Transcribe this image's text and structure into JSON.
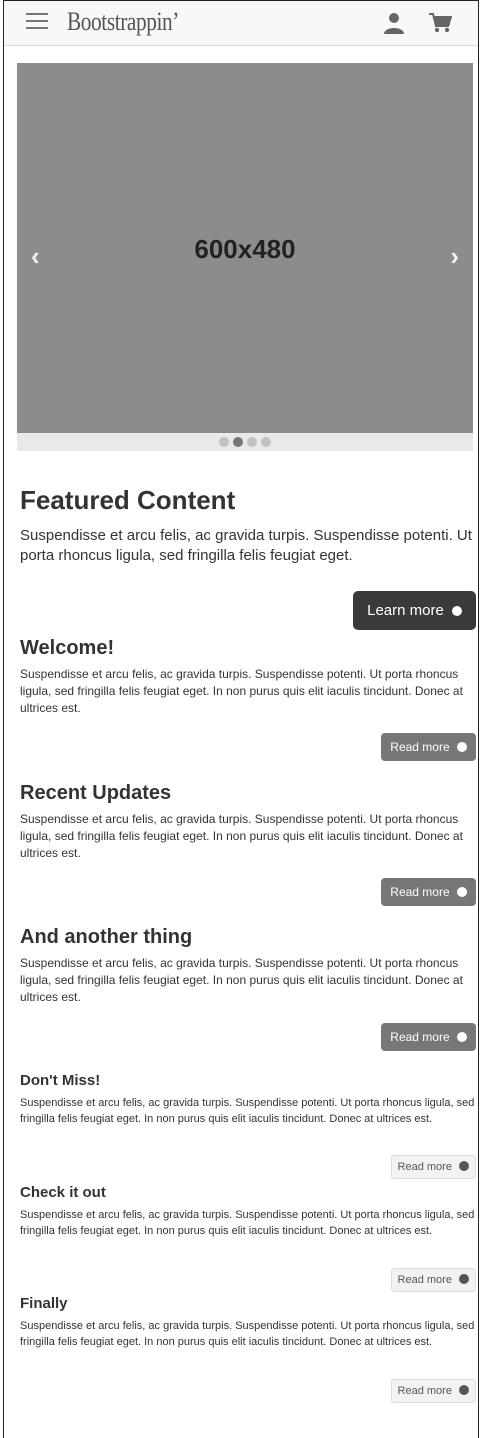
{
  "header": {
    "brand": "Bootstrappin’",
    "icons": [
      "menu-icon",
      "user-icon",
      "cart-icon"
    ]
  },
  "carousel": {
    "label": "600x480",
    "prev": "‹",
    "next": "›",
    "indicators": 4,
    "active_index": 1
  },
  "featured": {
    "title": "Featured Content",
    "text": "Suspendisse et arcu felis, ac gravida turpis. Suspendisse potenti. Ut porta rhoncus ligula, sed fringilla felis feugiat eget.",
    "button": "Learn more"
  },
  "sections": [
    {
      "title": "Welcome!",
      "text": "Suspendisse et arcu felis, ac gravida turpis. Suspendisse potenti. Ut porta rhoncus ligula, sed fringilla felis feugiat eget. In non purus quis elit iaculis tincidunt. Donec at ultrices est.",
      "button": "Read more"
    },
    {
      "title": "Recent Updates",
      "text": "Suspendisse et arcu felis, ac gravida turpis. Suspendisse potenti. Ut porta rhoncus ligula, sed fringilla felis feugiat eget. In non purus quis elit iaculis tincidunt. Donec at ultrices est.",
      "button": "Read more"
    },
    {
      "title": "And another thing",
      "text": "Suspendisse et arcu felis, ac gravida turpis. Suspendisse potenti. Ut porta rhoncus ligula, sed fringilla felis feugiat eget. In non purus quis elit iaculis tincidunt. Donec at ultrices est.",
      "button": "Read more"
    }
  ],
  "minor": [
    {
      "title": "Don't Miss!",
      "text": "Suspendisse et arcu felis, ac gravida turpis. Suspendisse potenti. Ut porta rhoncus ligula, sed fringilla felis feugiat eget. In non purus quis elit iaculis tincidunt. Donec at ultrices est.",
      "button": "Read more"
    },
    {
      "title": "Check it out",
      "text": "Suspendisse et arcu felis, ac gravida turpis. Suspendisse potenti. Ut porta rhoncus ligula, sed fringilla felis feugiat eget. In non purus quis elit iaculis tincidunt. Donec at ultrices est.",
      "button": "Read more"
    },
    {
      "title": "Finally",
      "text": "Suspendisse et arcu felis, ac gravida turpis. Suspendisse potenti. Ut porta rhoncus ligula, sed fringilla felis feugiat eget. In non purus quis elit iaculis tincidunt. Donec at ultrices est.",
      "button": "Read more"
    }
  ],
  "colors": {
    "carousel_bg": "#8c8c8c",
    "btn_dark": "#3a3a3a",
    "btn_mid": "#777777"
  }
}
